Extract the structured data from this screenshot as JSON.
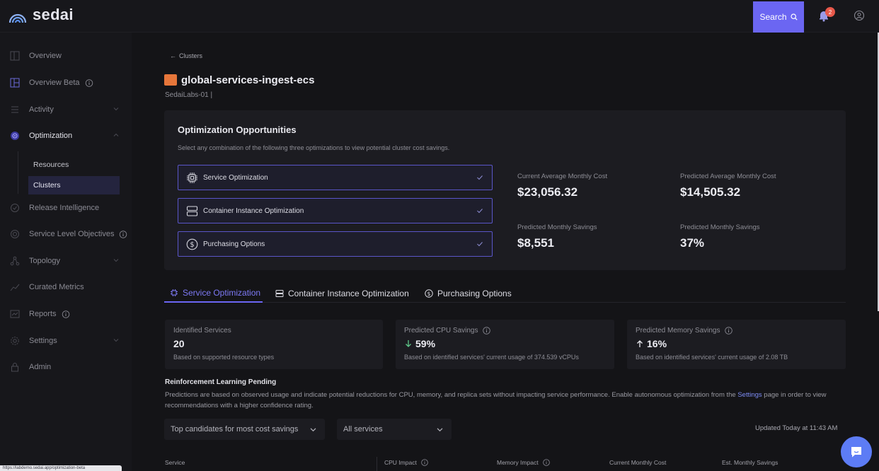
{
  "brand": {
    "name": "sedai"
  },
  "topbar": {
    "search_label": "Search",
    "notification_count": "2"
  },
  "sidebar": {
    "items": [
      {
        "id": "overview",
        "label": "Overview"
      },
      {
        "id": "overview-beta",
        "label": "Overview Beta"
      },
      {
        "id": "activity",
        "label": "Activity"
      },
      {
        "id": "optimization",
        "label": "Optimization"
      },
      {
        "id": "release-intelligence",
        "label": "Release Intelligence"
      },
      {
        "id": "slo",
        "label": "Service Level Objectives"
      },
      {
        "id": "topology",
        "label": "Topology"
      },
      {
        "id": "curated-metrics",
        "label": "Curated Metrics"
      },
      {
        "id": "reports",
        "label": "Reports"
      },
      {
        "id": "settings",
        "label": "Settings"
      },
      {
        "id": "admin",
        "label": "Admin"
      }
    ],
    "sub_items": [
      {
        "label": "Resources"
      },
      {
        "label": "Clusters"
      }
    ]
  },
  "breadcrumb": {
    "label": "Clusters"
  },
  "cluster": {
    "name": "global-services-ingest-ecs",
    "account": "SedaiLabs-01 |"
  },
  "opportunities": {
    "title": "Optimization Opportunities",
    "description": "Select any combination of the following three optimizations to view potential cluster cost savings.",
    "options": [
      {
        "label": "Service Optimization",
        "checked": true
      },
      {
        "label": "Container Instance Optimization",
        "checked": true
      },
      {
        "label": "Purchasing Options",
        "checked": true
      }
    ],
    "metrics": [
      {
        "label": "Current Average Monthly Cost",
        "value": "$23,056.32"
      },
      {
        "label": "Predicted Average Monthly Cost",
        "value": "$14,505.32"
      },
      {
        "label": "Predicted Monthly Savings",
        "value": "$8,551"
      },
      {
        "label": "Predicted Monthly Savings",
        "value": "37%"
      }
    ]
  },
  "tabs": [
    {
      "label": "Service Optimization",
      "active": true
    },
    {
      "label": "Container Instance Optimization",
      "active": false
    },
    {
      "label": "Purchasing Options",
      "active": false
    }
  ],
  "stats": [
    {
      "label": "Identified Services",
      "value": "20",
      "note": "Based on supported resource types"
    },
    {
      "label": "Predicted CPU Savings",
      "value": "59%",
      "direction": "down",
      "note": "Based on identified services' current usage of 374.539 vCPUs"
    },
    {
      "label": "Predicted Memory Savings",
      "value": "16%",
      "direction": "up",
      "note": "Based on identified services' current usage of 2.08 TB"
    }
  ],
  "rl": {
    "title": "Reinforcement Learning Pending",
    "text_before": "Predictions are based on observed usage and indicate potential reductions for CPU, memory, and replica sets without impacting service performance. Enable autonomous optimization from the ",
    "link": "Settings",
    "text_after": " page in order to view recommendations with a higher confidence rating."
  },
  "filters": {
    "sort": "Top candidates for most cost savings",
    "scope": "All services",
    "updated": "Updated Today at 11:43 AM"
  },
  "table": {
    "columns": [
      "Service",
      "CPU Impact",
      "Memory Impact",
      "Current Monthly Cost",
      "Est. Monthly Savings"
    ]
  },
  "status_url": "https://labdemo.sedai.app/optimization-beta",
  "colors": {
    "accent": "#6b66f2",
    "panel": "#1c1c21",
    "background": "#141417",
    "cluster_icon": "#e6763a"
  }
}
